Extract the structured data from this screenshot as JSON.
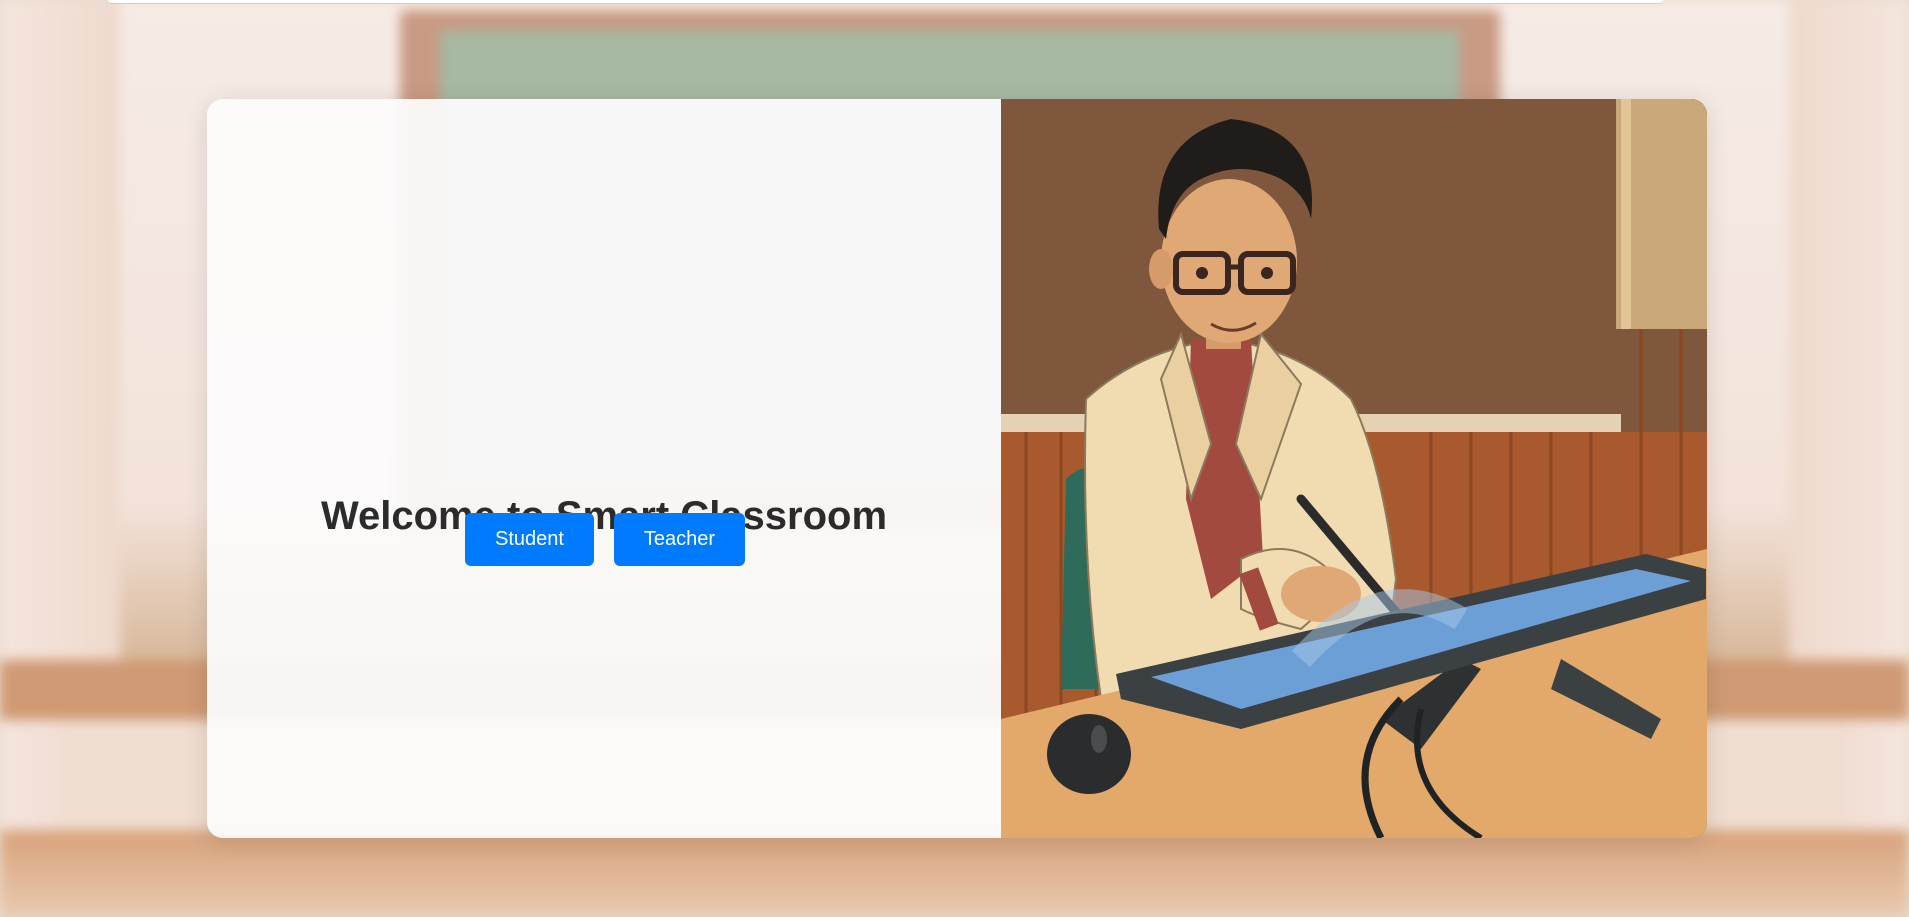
{
  "page": {
    "title": "Welcome to Smart Classroom"
  },
  "buttons": {
    "student_label": "Student",
    "teacher_label": "Teacher"
  },
  "colors": {
    "primary_button": "#007bff",
    "title_text": "#2b2b2b",
    "card_left_bg": "#fcfcfc"
  },
  "illustration": {
    "icon": "teacher-with-drawing-tablet-illustration"
  }
}
